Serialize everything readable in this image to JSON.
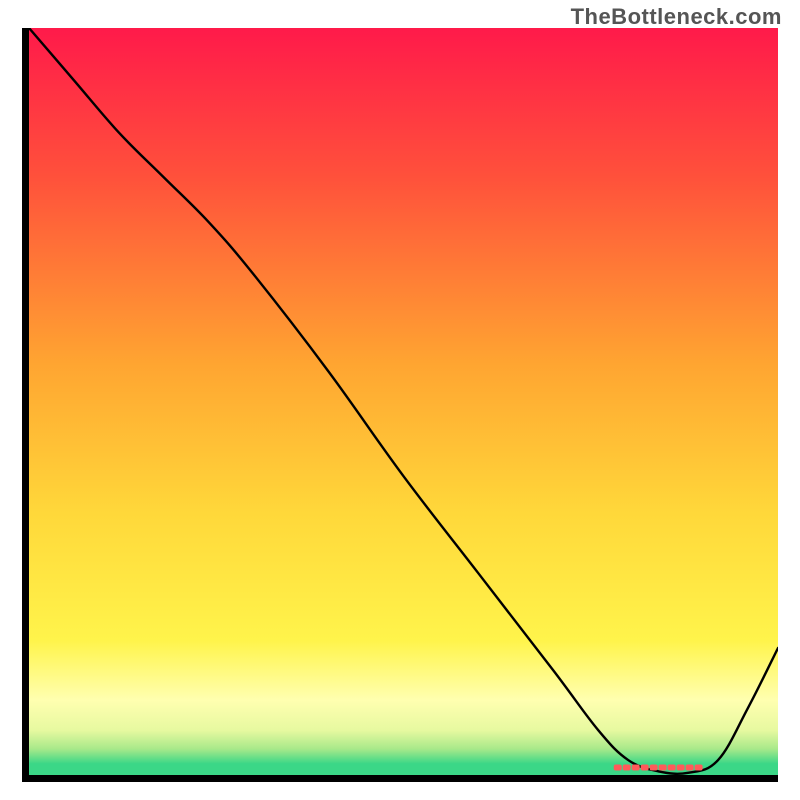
{
  "watermark": "TheBottleneck.com",
  "chart_data": {
    "type": "line",
    "title": "",
    "xlabel": "",
    "ylabel": "",
    "xlim": [
      0,
      100
    ],
    "ylim": [
      0,
      100
    ],
    "gradient_stops": [
      {
        "offset": 0.0,
        "color": "#ff1a4a"
      },
      {
        "offset": 0.2,
        "color": "#ff513b"
      },
      {
        "offset": 0.45,
        "color": "#ffa531"
      },
      {
        "offset": 0.65,
        "color": "#ffd83a"
      },
      {
        "offset": 0.82,
        "color": "#fff44b"
      },
      {
        "offset": 0.9,
        "color": "#ffffb0"
      },
      {
        "offset": 0.94,
        "color": "#e7f9a0"
      },
      {
        "offset": 0.965,
        "color": "#a8e98a"
      },
      {
        "offset": 0.985,
        "color": "#3bd787"
      }
    ],
    "curve": {
      "x": [
        0,
        6,
        12,
        18,
        24,
        30,
        40,
        50,
        60,
        70,
        76,
        80,
        84,
        88,
        92,
        96,
        100
      ],
      "y": [
        100,
        93,
        86,
        80,
        74,
        67,
        54,
        40,
        27,
        14,
        6,
        2,
        0.5,
        0.3,
        2,
        9,
        17
      ]
    },
    "marker_band": {
      "x_start": 78,
      "x_end": 90,
      "y": 1.0,
      "color": "#ff5a5a"
    },
    "axes_color": "#000000",
    "curve_color": "#000000",
    "curve_width": 2.4
  }
}
